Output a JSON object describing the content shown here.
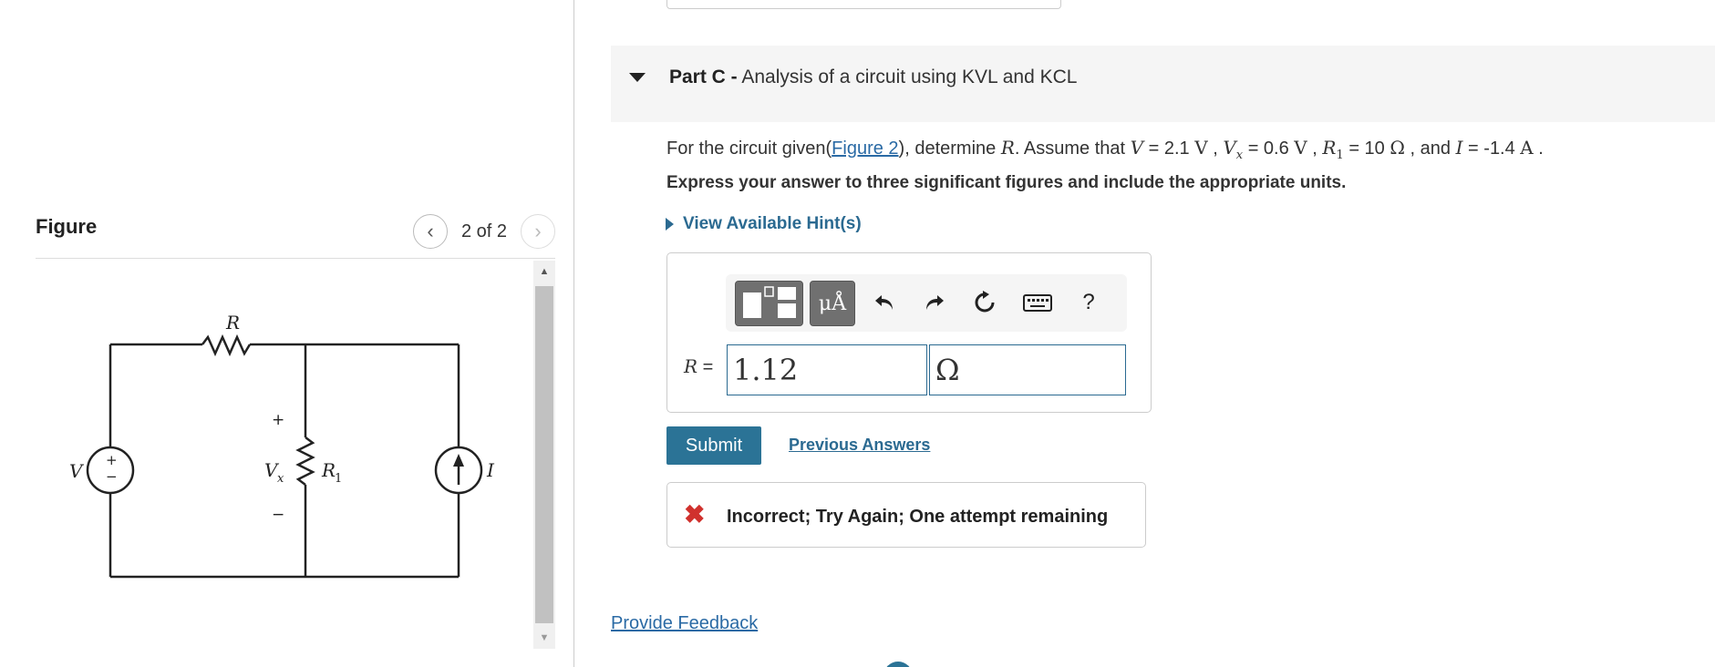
{
  "figure": {
    "title": "Figure",
    "counter": "2 of 2",
    "prev_icon": "chevron-left-icon",
    "next_icon": "chevron-right-icon",
    "circuit": {
      "label_R": "R",
      "label_V": "V",
      "label_Vx": "V",
      "label_Vx_sub": "x",
      "label_R1": "R",
      "label_R1_sub": "1",
      "label_I": "I",
      "plus": "+",
      "minus": "−"
    }
  },
  "part": {
    "label": "Part C -",
    "title": "Analysis of a circuit using KVL and KCL"
  },
  "question": {
    "prefix": "For the circuit given(",
    "figure_link": "Figure 2",
    "mid": "), determine ",
    "var_R": "R",
    "assume": ". Assume that ",
    "var_V": "V",
    "eq_V": " = 2.1 ",
    "unit_V1": "V",
    "sep1": " , ",
    "var_Vx": "V",
    "var_Vx_sub": "x",
    "eq_Vx": " = 0.6 ",
    "unit_V2": "V",
    "sep2": " , ",
    "var_R1": "R",
    "var_R1_sub": "1",
    "eq_R1": " = 10 ",
    "unit_ohm": "Ω",
    "and": " , and ",
    "var_I": "I",
    "eq_I": " = -1.4 ",
    "unit_A": "A",
    "end": " ."
  },
  "instruction": "Express your answer to three significant figures and include the appropriate units.",
  "hints_label": "View Available Hint(s)",
  "toolbar": {
    "units_label": "μÅ",
    "undo_icon": "undo-icon",
    "redo_icon": "redo-icon",
    "reset_icon": "reset-icon",
    "keyboard_icon": "keyboard-icon",
    "help_label": "?"
  },
  "answer": {
    "label": "R =",
    "value": "1.12",
    "unit": "Ω"
  },
  "submit_label": "Submit",
  "previous_answers_label": "Previous Answers",
  "feedback": {
    "icon": "x-icon",
    "mark": "✖",
    "text": "Incorrect; Try Again; One attempt remaining"
  },
  "provide_feedback_label": "Provide Feedback",
  "colors": {
    "link": "#2a6aa5",
    "submit_bg": "#2b7396",
    "error": "#d0312d"
  }
}
